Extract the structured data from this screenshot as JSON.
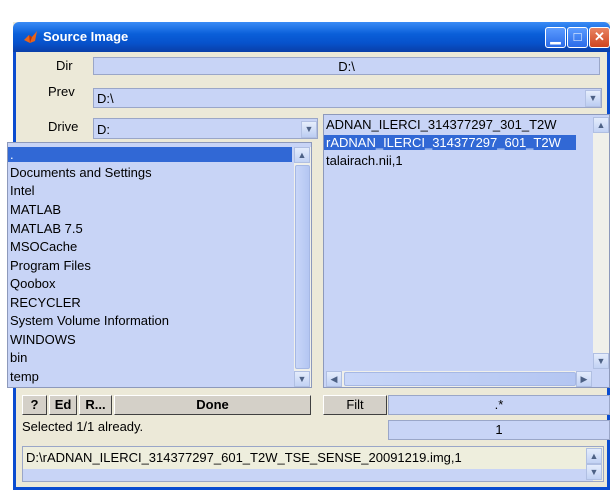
{
  "window": {
    "title": "Source Image"
  },
  "dir": {
    "label": "Dir",
    "value": "D:\\"
  },
  "prev": {
    "label": "Prev",
    "value": "D:\\"
  },
  "drive": {
    "label": "Drive",
    "value": "D:"
  },
  "folders": [
    ".",
    "Documents and Settings",
    "Intel",
    "MATLAB",
    "MATLAB 7.5",
    "MSOCache",
    "Program Files",
    "Qoobox",
    "RECYCLER",
    "System Volume Information",
    "WINDOWS",
    "bin",
    "temp"
  ],
  "files": [
    "ADNAN_ILERCI_314377297_301_T2W",
    "rADNAN_ILERCI_314377297_601_T2W",
    "talairach.nii,1"
  ],
  "buttons": {
    "help": "?",
    "edit": "Ed",
    "recent": "R...",
    "done": "Done",
    "filter": "Filt"
  },
  "filter": {
    "value": ".*"
  },
  "status": {
    "text": "Selected 1/1 already.",
    "count": "1"
  },
  "selection": {
    "path": "D:\\rADNAN_ILERCI_314377297_601_T2W_TSE_SENSE_20091219.img,1"
  }
}
